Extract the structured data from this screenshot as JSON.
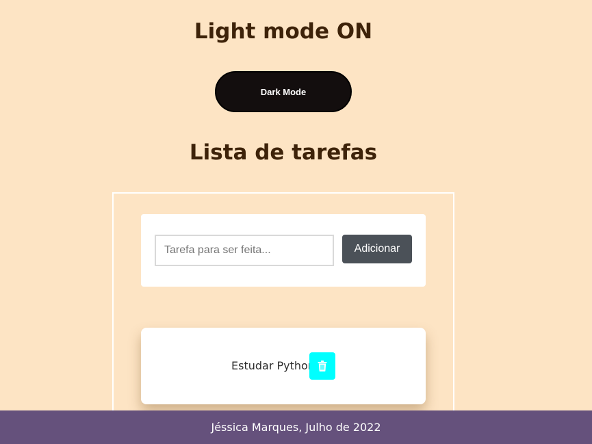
{
  "header": {
    "mode_status": "Light mode ON",
    "toggle_label": "Dark Mode"
  },
  "todo": {
    "title": "Lista de tarefas",
    "input_placeholder": "Tarefa para ser feita...",
    "input_value": "",
    "add_label": "Adicionar",
    "tasks": [
      {
        "text": "Estudar Python",
        "delete_icon": "trash-icon"
      }
    ]
  },
  "footer": {
    "text": "Jéssica Marques, Julho de 2022"
  },
  "colors": {
    "background": "#fde4c4",
    "heading": "#3d2209",
    "toggle": "#130e0e",
    "add_button": "#4b5158",
    "delete_button": "#00ffff",
    "footer": "#65517c"
  }
}
